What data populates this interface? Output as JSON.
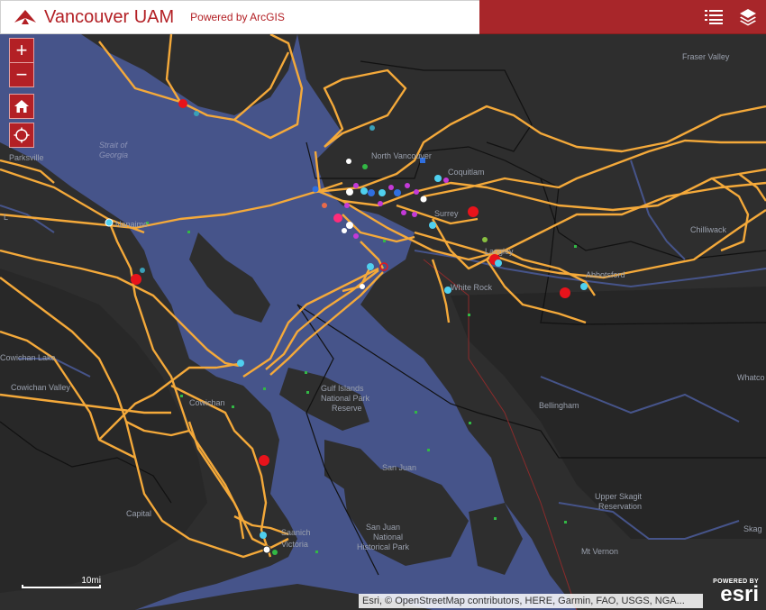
{
  "header": {
    "title": "Vancouver UAM",
    "powered_by": "Powered by ArcGIS",
    "accent": "#b32025",
    "bar_color": "#a8262a"
  },
  "controls": {
    "zoom_in": "+",
    "zoom_out": "−",
    "home_icon": "home-icon",
    "locate_icon": "crosshair-icon",
    "legend_icon": "legend-list-icon",
    "layers_icon": "layers-icon"
  },
  "map": {
    "colors": {
      "water": "#46548a",
      "land": "#2e2e2e",
      "route": "#f4a93a",
      "marker_red": "#e8131b",
      "marker_cyan": "#4fd0ef",
      "marker_white": "#ffffff",
      "marker_magenta": "#c43ad8",
      "marker_green": "#32b845"
    },
    "labels": {
      "fraser_valley": "Fraser Valley",
      "strait_of": "Strait of",
      "georgia": "Georgia",
      "parksville": "Parksville",
      "nanaimo": "Nanaimo",
      "north_vancouver": "North Vancouver",
      "coquitlam": "Coquitlam",
      "surrey": "Surrey",
      "langley": "Langley",
      "abbotsford": "Abbotsford",
      "chilliwack": "Chilliwack",
      "white_rock": "White Rock",
      "cowichan_lake": "Cowichan Lake",
      "cowichan_valley": "Cowichan Valley",
      "cowichan": "Cowichan",
      "gulf1": "Gulf Islands",
      "gulf2": "National Park",
      "gulf3": "Reserve",
      "whatcom": "Whatco",
      "bellingham": "Bellingham",
      "capital": "Capital",
      "saanich": "Saanich",
      "victoria": "Victoria",
      "san_juan": "San Juan",
      "sj1": "San Juan",
      "sj2": "National",
      "sj3": "Historical Park",
      "upper_skagit1": "Upper Skagit",
      "upper_skagit2": "Reservation",
      "mt_vernon": "Mt Vernon",
      "skagit": "Skag",
      "l": "L"
    }
  },
  "scale": {
    "label": "10mi"
  },
  "attribution": "Esri, © OpenStreetMap contributors, HERE, Garmin, FAO, USGS, NGA...",
  "esri": {
    "powered": "POWERED BY",
    "logo": "esri"
  }
}
